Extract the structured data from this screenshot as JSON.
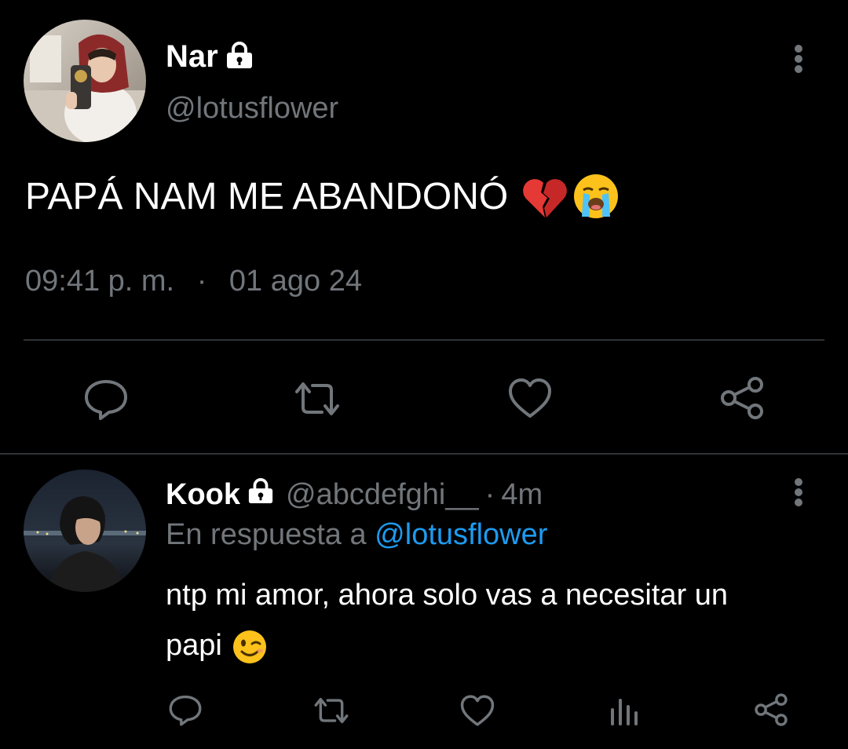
{
  "main_tweet": {
    "author_name": "Nar",
    "author_handle": "@lotusflower",
    "text": "PAPÁ NAM ME ABANDONÓ",
    "emojis": [
      "broken-heart",
      "loudly-crying-face"
    ],
    "time": "09:41 p. m.",
    "separator": "·",
    "date": "01 ago 24",
    "actions": [
      "reply",
      "retweet",
      "like",
      "share"
    ]
  },
  "reply_tweet": {
    "author_name": "Kook",
    "author_handle": "@abcdefghi__",
    "separator": "·",
    "age": "4m",
    "reply_prefix": "En respuesta a",
    "reply_to": "@lotusflower",
    "text_line1": "ntp mi amor, ahora solo vas a necesitar un",
    "text_line2": "papi",
    "emojis": [
      "winking-face"
    ],
    "actions": [
      "reply",
      "retweet",
      "like",
      "views",
      "share"
    ]
  },
  "colors": {
    "background": "#000000",
    "text": "#ffffff",
    "secondary": "#71767b",
    "link": "#1d9bf0",
    "divider": "#2f3336"
  }
}
